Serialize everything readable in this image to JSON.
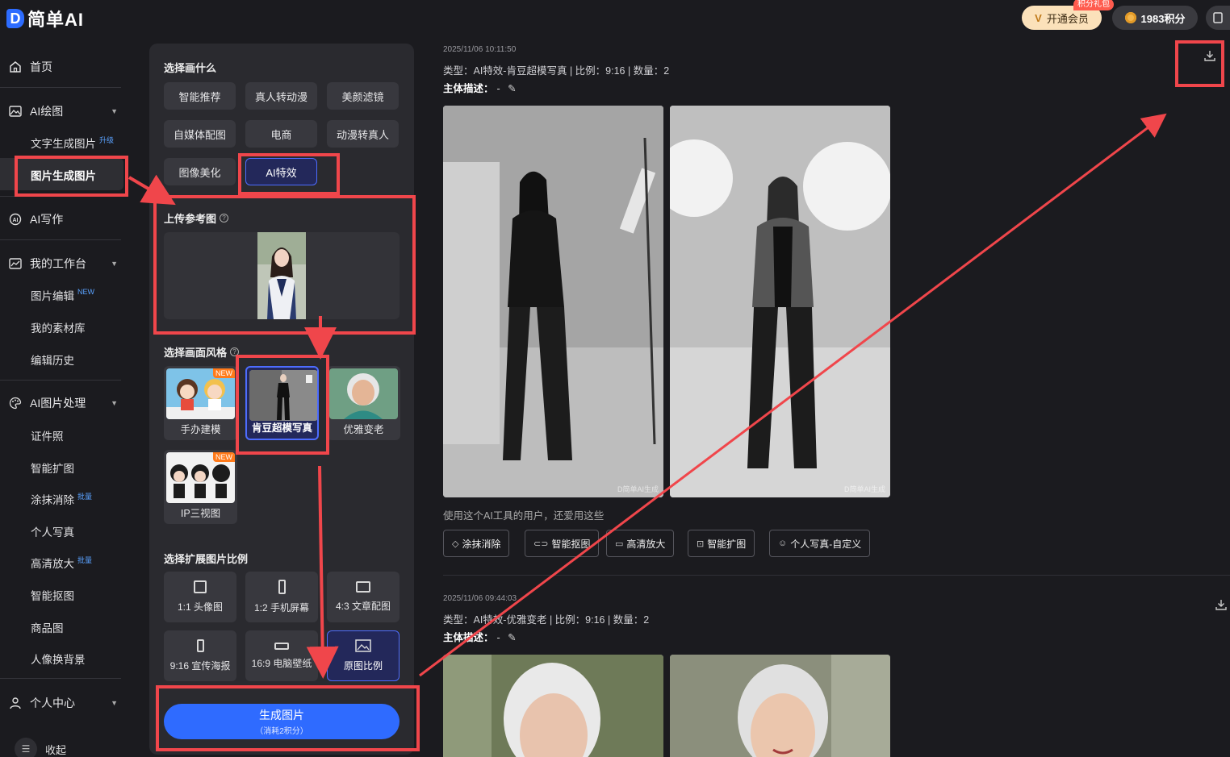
{
  "app": {
    "logo_letter": "D",
    "logo_text": "简单AI"
  },
  "topbar": {
    "vip_label": "开通会员",
    "vip_badge": "积分礼包",
    "points_label": "1983积分",
    "colors": {
      "vip_bg": "#fbe1ba",
      "badge": "#ff5b4e",
      "accent": "#2f6bff"
    }
  },
  "sidebar": {
    "home": "首页",
    "ai_draw": "AI绘图",
    "text_to_image": "文字生成图片",
    "text_to_image_tag": "升级",
    "image_to_image": "图片生成图片",
    "ai_write": "AI写作",
    "workspace": "我的工作台",
    "image_edit": "图片编辑",
    "image_edit_tag": "NEW",
    "materials": "我的素材库",
    "history": "编辑历史",
    "ai_image_process": "AI图片处理",
    "id_photo": "证件照",
    "smart_expand": "智能扩图",
    "erase": "涂抹消除",
    "erase_tag": "批量",
    "portrait": "个人写真",
    "upscale": "高清放大",
    "upscale_tag": "批量",
    "cutout": "智能抠图",
    "product": "商品图",
    "bg_change": "人像换背景",
    "personal_center": "个人中心",
    "collapse": "收起"
  },
  "panel": {
    "choose_title": "选择画什么",
    "chips": [
      "智能推荐",
      "真人转动漫",
      "美颜滤镜",
      "自媒体配图",
      "电商",
      "动漫转真人",
      "图像美化",
      "AI特效"
    ],
    "active_chip": "AI特效",
    "upload_title": "上传参考图",
    "style_title": "选择画面风格",
    "styles": [
      {
        "label": "手办建模",
        "new": "NEW"
      },
      {
        "label": "肯豆超模写真",
        "new": ""
      },
      {
        "label": "优雅变老",
        "new": ""
      },
      {
        "label": "IP三视图",
        "new": "NEW"
      }
    ],
    "ratio_title": "选择扩展图片比例",
    "ratios": [
      "1:1 头像图",
      "1:2 手机屏幕",
      "4:3 文章配图",
      "9:16 宣传海报",
      "16:9 电脑壁纸",
      "原图比例"
    ],
    "generate_label": "生成图片",
    "generate_cost": "（消耗2积分）"
  },
  "results": [
    {
      "time": "2025/11/06 10:11:50",
      "type_line": "类型：AI特效-肯豆超模写真 | 比例：9:16 | 数量：2",
      "desc_label": "主体描述：",
      "desc_value": "-"
    },
    {
      "time": "2025/11/06 09:44:03",
      "type_line": "类型：AI特效-优雅变老 | 比例：9:16 | 数量：2",
      "desc_label": "主体描述：",
      "desc_value": "-"
    }
  ],
  "watermark": "D简单AI生成",
  "also_used": "使用这个AI工具的用户，还爱用这些",
  "tools": [
    "涂抹消除",
    "智能抠图",
    "高清放大",
    "智能扩图",
    "个人写真-自定义"
  ],
  "annotation_color": "#f0464b"
}
